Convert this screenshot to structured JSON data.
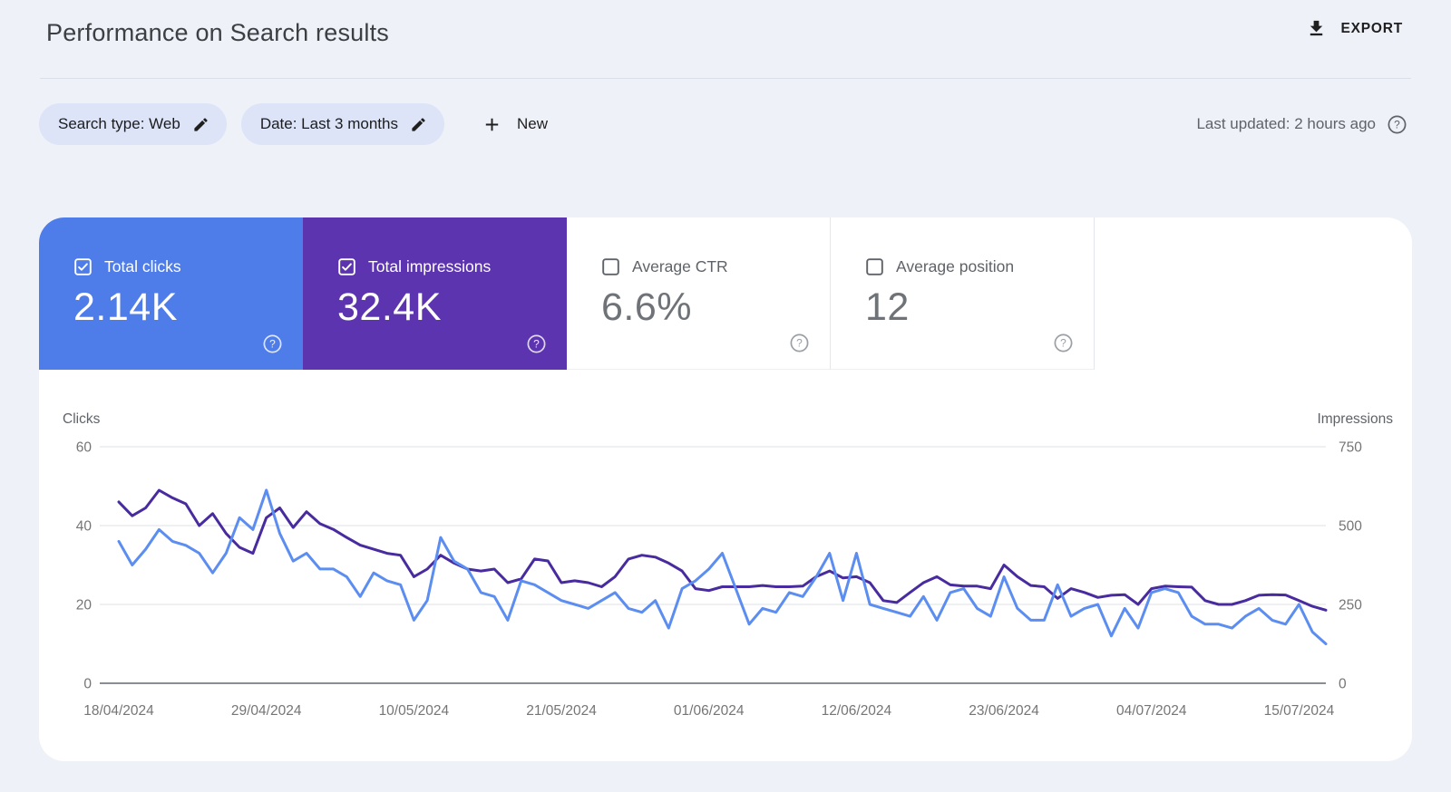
{
  "header": {
    "title": "Performance on Search results",
    "export_label": "EXPORT"
  },
  "filters": {
    "chips": [
      {
        "label": "Search type: Web"
      },
      {
        "label": "Date: Last 3 months"
      }
    ],
    "new_button_label": "New",
    "last_updated": "Last updated: 2 hours ago"
  },
  "metrics": {
    "clicks": {
      "label": "Total clicks",
      "value": "2.14K",
      "checked": true,
      "color": "#4e7ce9"
    },
    "impressions": {
      "label": "Total impressions",
      "value": "32.4K",
      "checked": true,
      "color": "#5d34af"
    },
    "ctr": {
      "label": "Average CTR",
      "value": "6.6%",
      "checked": false
    },
    "position": {
      "label": "Average position",
      "value": "12",
      "checked": false
    }
  },
  "chart_data": {
    "type": "line",
    "title": "",
    "x_tick_labels": [
      "18/04/2024",
      "29/04/2024",
      "10/05/2024",
      "21/05/2024",
      "01/06/2024",
      "12/06/2024",
      "23/06/2024",
      "04/07/2024",
      "15/07/2024"
    ],
    "x_points": 91,
    "x_tick_every_days": 11,
    "left_axis": {
      "title": "Clicks",
      "ticks": [
        0,
        20,
        40,
        60
      ],
      "range": [
        0,
        60
      ]
    },
    "right_axis": {
      "title": "Impressions",
      "ticks": [
        0,
        250,
        500,
        750
      ],
      "range": [
        0,
        750
      ]
    },
    "grid": true,
    "legend_position": "none",
    "series": [
      {
        "name": "Total clicks",
        "axis": "left",
        "color": "#5c8df0",
        "values": [
          36,
          30,
          34,
          39,
          36,
          35,
          33,
          28,
          33,
          42,
          39,
          49,
          38,
          31,
          33,
          29,
          29,
          27,
          22,
          28,
          26,
          25,
          16,
          21,
          37,
          31,
          29,
          23,
          22,
          16,
          26,
          25,
          23,
          21,
          20,
          19,
          21,
          23,
          19,
          18,
          21,
          14,
          24,
          26,
          29,
          33,
          24,
          15,
          19,
          18,
          23,
          22,
          27,
          33,
          21,
          33,
          20,
          19,
          18,
          17,
          22,
          16,
          23,
          24,
          19,
          17,
          27,
          19,
          16,
          16,
          25,
          17,
          19,
          20,
          12,
          19,
          14,
          23,
          24,
          23,
          17,
          15,
          15,
          14,
          17,
          19,
          16,
          15,
          20,
          13,
          10
        ]
      },
      {
        "name": "Total impressions",
        "axis": "right",
        "color": "#482b9e",
        "values": [
          575,
          531,
          556,
          612,
          588,
          569,
          500,
          538,
          475,
          431,
          412,
          525,
          556,
          494,
          544,
          506,
          488,
          462,
          438,
          425,
          412,
          406,
          338,
          362,
          406,
          381,
          362,
          356,
          362,
          319,
          331,
          394,
          388,
          319,
          325,
          319,
          306,
          338,
          394,
          406,
          400,
          381,
          356,
          300,
          294,
          306,
          306,
          306,
          310,
          306,
          306,
          308,
          338,
          356,
          334,
          338,
          319,
          262,
          256,
          288,
          319,
          338,
          312,
          308,
          308,
          300,
          375,
          338,
          310,
          306,
          269,
          300,
          288,
          272,
          279,
          281,
          250,
          300,
          308,
          306,
          305,
          262,
          250,
          250,
          262,
          279,
          281,
          280,
          262,
          244,
          232
        ]
      }
    ]
  }
}
